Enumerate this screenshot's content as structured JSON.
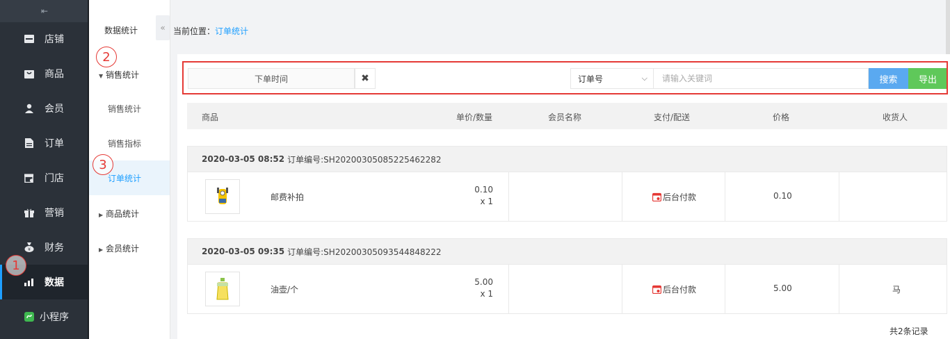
{
  "sidebar": {
    "collapse_glyph": "⇤",
    "items": [
      {
        "label": "店铺",
        "icon": "store-icon"
      },
      {
        "label": "商品",
        "icon": "bag-icon"
      },
      {
        "label": "会员",
        "icon": "user-icon"
      },
      {
        "label": "订单",
        "icon": "document-icon"
      },
      {
        "label": "门店",
        "icon": "shop-icon"
      },
      {
        "label": "营销",
        "icon": "gift-icon"
      },
      {
        "label": "财务",
        "icon": "money-bag-icon"
      },
      {
        "label": "数据",
        "icon": "chart-icon",
        "active": true
      },
      {
        "label": "小程序",
        "icon": "miniprogram-icon"
      }
    ]
  },
  "subnav": {
    "title": "数据统计",
    "fold_glyph": "«",
    "groups": {
      "sales": {
        "label": "销售统计",
        "expanded": true
      },
      "goods": {
        "label": "商品统计"
      },
      "members": {
        "label": "会员统计"
      }
    },
    "items": {
      "sales_stats": "销售统计",
      "sales_index": "销售指标",
      "order_stats": "订单统计"
    }
  },
  "annotations": [
    "1",
    "2",
    "3"
  ],
  "breadcrumb": {
    "prefix": "当前位置：",
    "current": "订单统计"
  },
  "filter": {
    "date_placeholder": "下单时间",
    "clear_glyph": "✖",
    "select_value": "订单号",
    "select_chevron": "⌵",
    "keyword_placeholder": "请输入关键词",
    "search_label": "搜索",
    "export_label": "导出"
  },
  "table": {
    "headers": [
      "商品",
      "单价/数量",
      "会员名称",
      "支付/配送",
      "价格",
      "收货人"
    ]
  },
  "orders": [
    {
      "time": "2020-03-05 08:52",
      "order_no": "订单编号:SH20200305085225462282",
      "product": "邮费补拍",
      "unit_price": "0.10",
      "qty": "x 1",
      "member": "",
      "payment": "后台付款",
      "price": "0.10",
      "receiver": ""
    },
    {
      "time": "2020-03-05 09:35",
      "order_no": "订单编号:SH20200305093544848222",
      "product": "油壶/个",
      "unit_price": "5.00",
      "qty": "x 1",
      "member": "",
      "payment": "后台付款",
      "price": "5.00",
      "receiver": "马"
    }
  ],
  "footer": {
    "total": "共2条记录"
  },
  "colors": {
    "accent": "#1e9fff",
    "sidebar_bg": "#2b3139",
    "search_btn": "#5aa9f0",
    "export_btn": "#5fc85a",
    "annotation": "#e53935"
  }
}
